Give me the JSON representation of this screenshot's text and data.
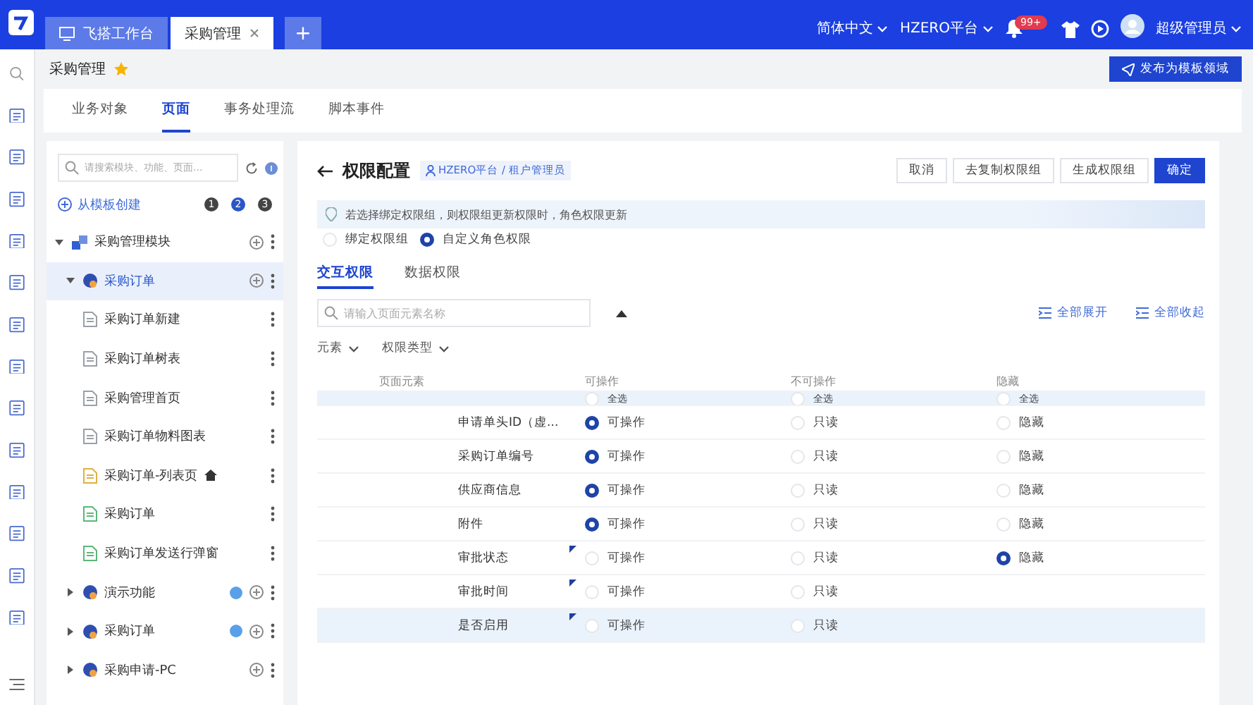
{
  "topbar": {
    "tabs": [
      {
        "label": "飞搭工作台",
        "selected": false,
        "closable": false
      },
      {
        "label": "采购管理",
        "selected": true,
        "closable": true
      }
    ],
    "add_tab": "+",
    "language": "简体中文",
    "tenant": "HZERO平台",
    "notification_count": "99+",
    "user": "超级管理员"
  },
  "page": {
    "title": "采购管理",
    "starred": true,
    "publish_button": "发布为模板领域"
  },
  "section_tabs": [
    {
      "label": "业务对象",
      "selected": false
    },
    {
      "label": "页面",
      "selected": true
    },
    {
      "label": "事务处理流",
      "selected": false
    },
    {
      "label": "脚本事件",
      "selected": false
    }
  ],
  "tree_panel": {
    "search_placeholder": "请搜索模块、功能、页面...",
    "create_button": "从模板创建",
    "steps": [
      {
        "label": "1",
        "selected": false
      },
      {
        "label": "2",
        "selected": true
      },
      {
        "label": "3",
        "selected": false
      }
    ],
    "items": [
      {
        "label": "采购管理模块",
        "kind": "module",
        "expanded": true,
        "selected": false,
        "badge": false,
        "children": [
          {
            "label": "采购订单",
            "kind": "function",
            "expanded": true,
            "selected": true,
            "badge": false,
            "children": [
              {
                "label": "采购订单新建",
                "kind": "page",
                "color": "#9aa0a8",
                "home": false
              },
              {
                "label": "采购订单树表",
                "kind": "page",
                "color": "#9aa0a8",
                "home": false
              },
              {
                "label": "采购管理首页",
                "kind": "page",
                "color": "#9aa0a8",
                "home": false
              },
              {
                "label": "采购订单物料图表",
                "kind": "page",
                "color": "#9aa0a8",
                "home": false
              },
              {
                "label": "采购订单-列表页",
                "kind": "page",
                "color": "#e0b040",
                "home": true
              },
              {
                "label": "采购订单",
                "kind": "page",
                "color": "#5cb87a",
                "home": false
              },
              {
                "label": "采购订单发送行弹窗",
                "kind": "page",
                "color": "#5cb87a",
                "home": false
              }
            ]
          },
          {
            "label": "演示功能",
            "kind": "function",
            "expanded": false,
            "selected": false,
            "badge": true
          },
          {
            "label": "采购订单",
            "kind": "function",
            "expanded": false,
            "selected": false,
            "badge": true
          },
          {
            "label": "采购申请-PC",
            "kind": "function",
            "expanded": false,
            "selected": false,
            "badge": false
          }
        ]
      }
    ]
  },
  "permission": {
    "title": "权限配置",
    "role": "HZERO平台 / 租户管理员",
    "buttons": [
      {
        "label": "取消",
        "primary": false
      },
      {
        "label": "去复制权限组",
        "primary": false
      },
      {
        "label": "生成权限组",
        "primary": false
      },
      {
        "label": "确定",
        "primary": true
      }
    ],
    "notice": "若选择绑定权限组，则权限组更新权限时，角色权限更新",
    "modes": [
      {
        "label": "绑定权限组",
        "selected": false
      },
      {
        "label": "自定义角色权限",
        "selected": true
      }
    ],
    "tabs": [
      {
        "label": "交互权限",
        "selected": true
      },
      {
        "label": "数据权限",
        "selected": false
      }
    ],
    "search_placeholder": "请输入页面元素名称",
    "expand_all": "全部展开",
    "collapse_all": "全部收起",
    "filters": [
      {
        "label": "元素"
      },
      {
        "label": "权限类型"
      }
    ],
    "columns": [
      "页面元素",
      "可操作",
      "不可操作",
      "隐藏"
    ],
    "rows": [
      {
        "kind": "select-all",
        "selected": true,
        "marked": false,
        "options": [
          {
            "label": "全选",
            "selected": false
          },
          {
            "label": "全选",
            "selected": false
          },
          {
            "label": "全选",
            "selected": false
          }
        ]
      },
      {
        "kind": "element",
        "label": "申请单头ID（虚...",
        "selected": false,
        "marked": false,
        "options": [
          {
            "label": "可操作",
            "selected": true
          },
          {
            "label": "只读",
            "selected": false
          },
          {
            "label": "隐藏",
            "selected": false
          }
        ]
      },
      {
        "kind": "element",
        "label": "采购订单编号",
        "selected": false,
        "marked": false,
        "options": [
          {
            "label": "可操作",
            "selected": true
          },
          {
            "label": "只读",
            "selected": false
          },
          {
            "label": "隐藏",
            "selected": false
          }
        ]
      },
      {
        "kind": "element",
        "label": "供应商信息",
        "selected": false,
        "marked": false,
        "options": [
          {
            "label": "可操作",
            "selected": true
          },
          {
            "label": "只读",
            "selected": false
          },
          {
            "label": "隐藏",
            "selected": false
          }
        ]
      },
      {
        "kind": "element",
        "label": "附件",
        "selected": false,
        "marked": false,
        "options": [
          {
            "label": "可操作",
            "selected": true
          },
          {
            "label": "只读",
            "selected": false
          },
          {
            "label": "隐藏",
            "selected": false
          }
        ]
      },
      {
        "kind": "element",
        "label": "审批状态",
        "selected": false,
        "marked": true,
        "options": [
          {
            "label": "可操作",
            "selected": false
          },
          {
            "label": "只读",
            "selected": false
          },
          {
            "label": "隐藏",
            "selected": true
          }
        ]
      },
      {
        "kind": "element",
        "label": "审批时间",
        "selected": false,
        "marked": true,
        "options": [
          {
            "label": "可操作",
            "selected": false
          },
          {
            "label": "只读",
            "selected": false
          }
        ]
      },
      {
        "kind": "element",
        "label": "是否启用",
        "selected": true,
        "marked": true,
        "options": [
          {
            "label": "可操作",
            "selected": false
          },
          {
            "label": "只读",
            "selected": false
          }
        ]
      }
    ]
  }
}
